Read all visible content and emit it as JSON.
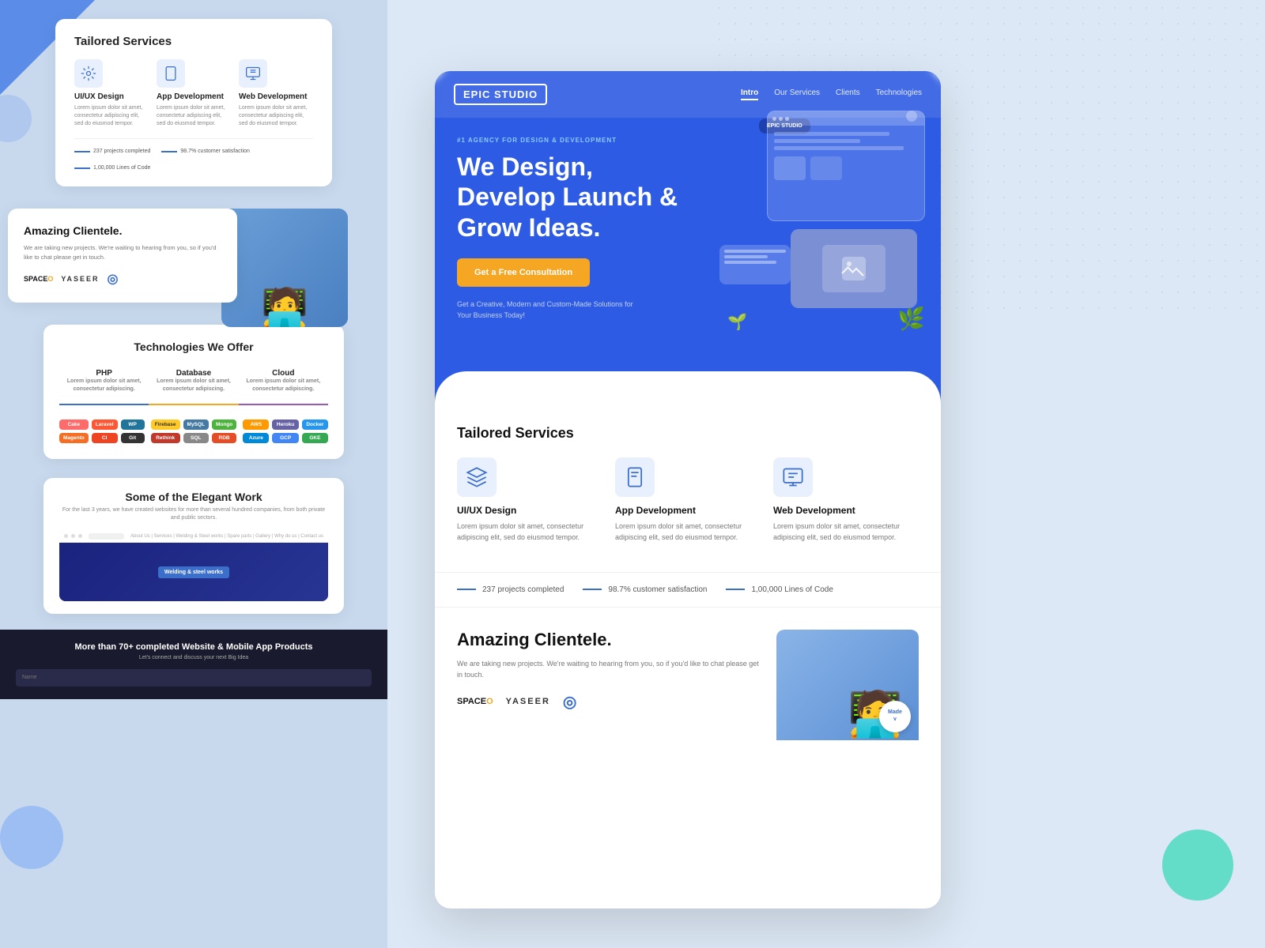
{
  "left_panel": {
    "card1": {
      "title": "Tailored Services",
      "services": [
        {
          "name": "UI/UX Design",
          "icon": "⚙"
        },
        {
          "name": "App Development",
          "icon": "📱"
        },
        {
          "name": "Web Development",
          "icon": "🌐"
        }
      ],
      "service_desc": "Lorem ipsum dolor sit amet, consectetur adipiscing elit, sed do eiusmod tempor.",
      "stats": [
        {
          "value": "237 projects completed"
        },
        {
          "value": "98.7% customer satisfaction"
        },
        {
          "value": "1,00,000 Lines of Code"
        }
      ]
    },
    "card2": {
      "title": "Amazing Clientele.",
      "desc": "We are taking new projects. We're waiting to hearing from you, so if you'd like to chat please get in touch.",
      "clients": [
        "SPACEO",
        "YASEER",
        "◎"
      ]
    },
    "card3": {
      "title": "Technologies We Offer",
      "tabs": [
        "PHP",
        "Database",
        "Cloud"
      ],
      "tab_desc": "Lorem ipsum dolor sit amet, consectetur adipiscing.",
      "php_logos": [
        "CakePHP",
        "Laravel",
        "WordPress",
        "Magento",
        "CodeIgniter",
        "GitHub"
      ],
      "db_logos": [
        "Firebase",
        "MySQL",
        "MongoDB",
        "RethinkDB",
        "SQL"
      ],
      "cloud_logos": [
        "AWS",
        "Heroku",
        "Docker",
        "Azure",
        "GCP"
      ]
    },
    "card4": {
      "title": "Some of the Elegant Work",
      "desc": "For the last 3 years, we have created websites for more than several hundred companies, from both private and public sectors.",
      "screenshot_label": "Welding & steel works"
    },
    "footer": {
      "title": "More than 70+ completed Website & Mobile App Products",
      "desc": "Let's connect and discuss your next Big Idea",
      "input_placeholder": "Name"
    }
  },
  "right_panel": {
    "nav": {
      "logo": "EPIC STUDIO",
      "links": [
        "Intro",
        "Our Services",
        "Clients",
        "Technologies"
      ],
      "active_link": "Intro"
    },
    "hero": {
      "badge": "#1 AGENCY FOR DESIGN & DEVELOPMENT",
      "title_line1": "We Design,",
      "title_line2": "Develop Launch &",
      "title_line3": "Grow Ideas.",
      "cta_label": "Get a Free Consultation",
      "sub_text": "Get a Creative, Modern and Custom-Made Solutions for Your Business Today!"
    },
    "services_section": {
      "title": "Tailored Services",
      "services": [
        {
          "name": "UI/UX Design",
          "desc": "Lorem ipsum dolor sit amet, consectetur adipiscing elit, sed do eiusmod tempor.",
          "icon": "⚙"
        },
        {
          "name": "App Development",
          "desc": "Lorem ipsum dolor sit amet, consectetur adipiscing elit, sed do eiusmod tempor.",
          "icon": "📱"
        },
        {
          "name": "Web Development",
          "desc": "Lorem ipsum dolor sit amet, consectetur adipiscing elit, sed do eiusmod tempor.",
          "icon": "🌐"
        }
      ]
    },
    "stats": [
      {
        "value": "237 projects completed"
      },
      {
        "value": "98.7% customer satisfaction"
      },
      {
        "value": "1,00,000 Lines of Code"
      }
    ],
    "clientele": {
      "title": "Amazing Clientele.",
      "desc": "We are taking new projects. We're waiting to hearing from you, so if you'd like to chat please get in touch.",
      "clients": [
        "SPACEO",
        "YASEER",
        "◎"
      ]
    }
  },
  "colors": {
    "blue_primary": "#2d5be3",
    "yellow_cta": "#f5a623",
    "bg_light": "#dce8f5",
    "text_dark": "#111111",
    "text_muted": "#777777"
  }
}
